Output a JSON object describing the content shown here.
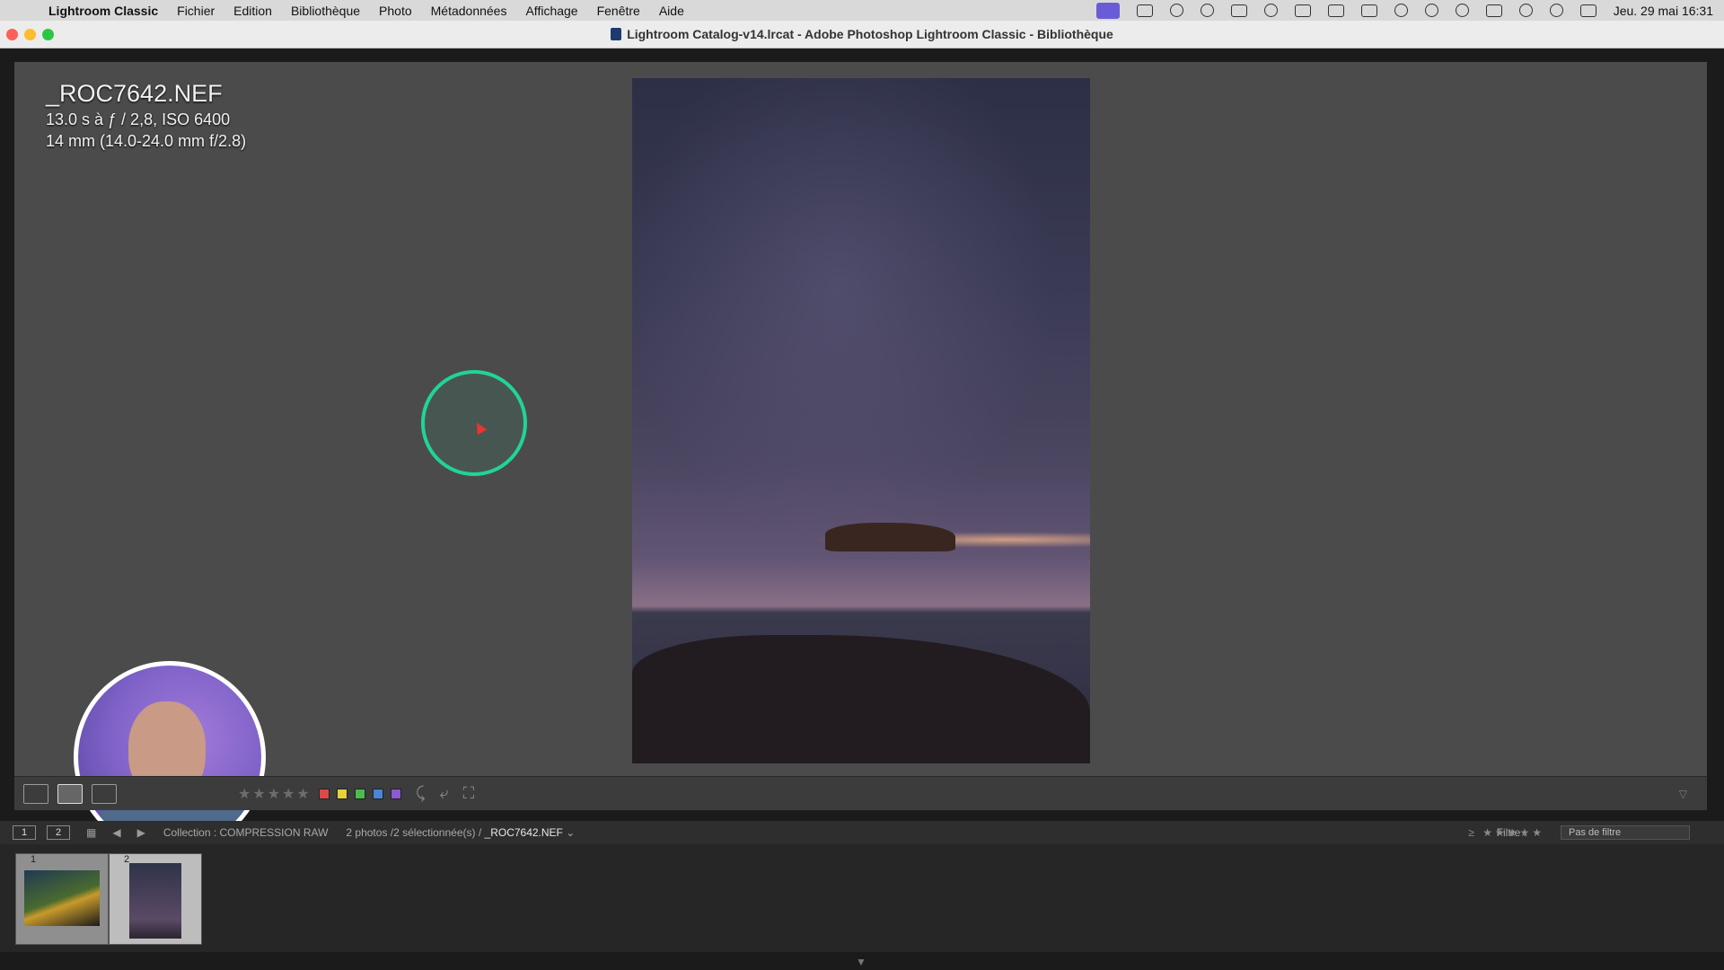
{
  "menubar": {
    "app": "Lightroom Classic",
    "items": [
      "Fichier",
      "Edition",
      "Bibliothèque",
      "Photo",
      "Métadonnées",
      "Affichage",
      "Fenêtre",
      "Aide"
    ],
    "clock": "Jeu. 29 mai  16:31"
  },
  "window": {
    "title": "Lightroom Catalog-v14.lrcat - Adobe Photoshop Lightroom Classic - Bibliothèque"
  },
  "loupe": {
    "filename": "_ROC7642.NEF",
    "exposure": "13.0 s à ƒ / 2,8, ISO 6400",
    "lens": "14 mm (14.0-24.0 mm f/2.8)"
  },
  "toolbar": {
    "swatch_colors": [
      "#e04848",
      "#e6d33a",
      "#4cbd4c",
      "#4b84d8",
      "#8e58d0"
    ]
  },
  "filmhead": {
    "screen1": "1",
    "screen2": "2",
    "collection": "Collection : COMPRESSION RAW",
    "selection_prefix": "2 photos /2 sélectionnée(s) /",
    "selection_file": "_ROC7642.NEF",
    "filter_label": "Filtre :",
    "filter_value": "Pas de filtre"
  },
  "filmstrip": {
    "cells": [
      {
        "index": "1"
      },
      {
        "index": "2"
      }
    ]
  }
}
